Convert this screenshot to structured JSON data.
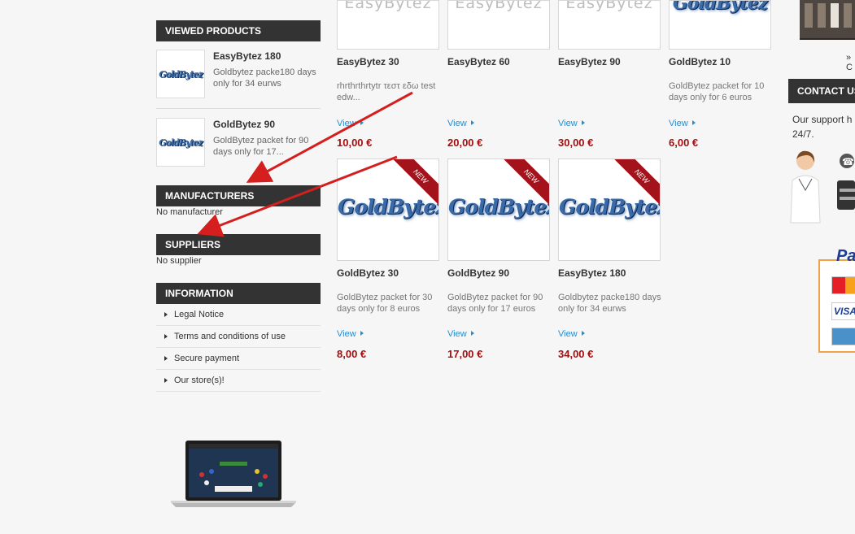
{
  "left": {
    "viewed_title": "VIEWED PRODUCTS",
    "viewed_items": [
      {
        "name": "EasyBytez 180",
        "desc": "Goldbytez packe180 days only for 34 eurws",
        "logo": "GoldBytez"
      },
      {
        "name": "GoldBytez 90",
        "desc": "GoldBytez packet for 90 days only for 17...",
        "logo": "GoldBytez"
      }
    ],
    "manufacturers_title": "MANUFACTURERS",
    "manufacturers_text": "No manufacturer",
    "suppliers_title": "SUPPLIERS",
    "suppliers_text": "No supplier",
    "information_title": "INFORMATION",
    "information_links": [
      "Legal Notice",
      "Terms and conditions of use",
      "Secure payment",
      "Our store(s)!"
    ]
  },
  "products_row1": [
    {
      "name": "EasyBytez 30",
      "desc": "rhrthrthrtytr τεστ εδω test edw...",
      "view": "View",
      "price": "10,00 €",
      "logo": "EasyBytez"
    },
    {
      "name": "EasyBytez 60",
      "desc": "",
      "view": "View",
      "price": "20,00 €",
      "logo": "EasyBytez"
    },
    {
      "name": "EasyBytez 90",
      "desc": "",
      "view": "View",
      "price": "30,00 €",
      "logo": "EasyBytez"
    },
    {
      "name": "GoldBytez 10",
      "desc": "GoldBytez packet for 10 days only for 6 euros",
      "view": "View",
      "price": "6,00 €",
      "logo": "GoldBytez"
    }
  ],
  "products_row2": [
    {
      "name": "GoldBytez 30",
      "desc": "GoldBytez packet for 30 days only for 8 euros",
      "view": "View",
      "price": "8,00 €",
      "logo": "GoldBytez",
      "badge": "NEW"
    },
    {
      "name": "GoldBytez 90",
      "desc": "GoldBytez packet for 90 days only for 17 euros",
      "view": "View",
      "price": "17,00 €",
      "logo": "GoldBytez",
      "badge": "NEW"
    },
    {
      "name": "EasyBytez 180",
      "desc": "Goldbytez packe180 days only for 34 eurws",
      "view": "View",
      "price": "34,00 €",
      "logo": "GoldBytez",
      "badge": "NEW"
    }
  ],
  "right": {
    "contact_title": "CONTACT US",
    "support_text_1": "Our support h",
    "support_text_2": "24/7.",
    "payment_label": "Pa",
    "link_partial": "» C"
  },
  "colors": {
    "header_bg": "#333333",
    "price": "#a30e0e",
    "link": "#2a8bc9",
    "ribbon": "#a4121b",
    "annotation_arrow": "#d51f1f"
  }
}
